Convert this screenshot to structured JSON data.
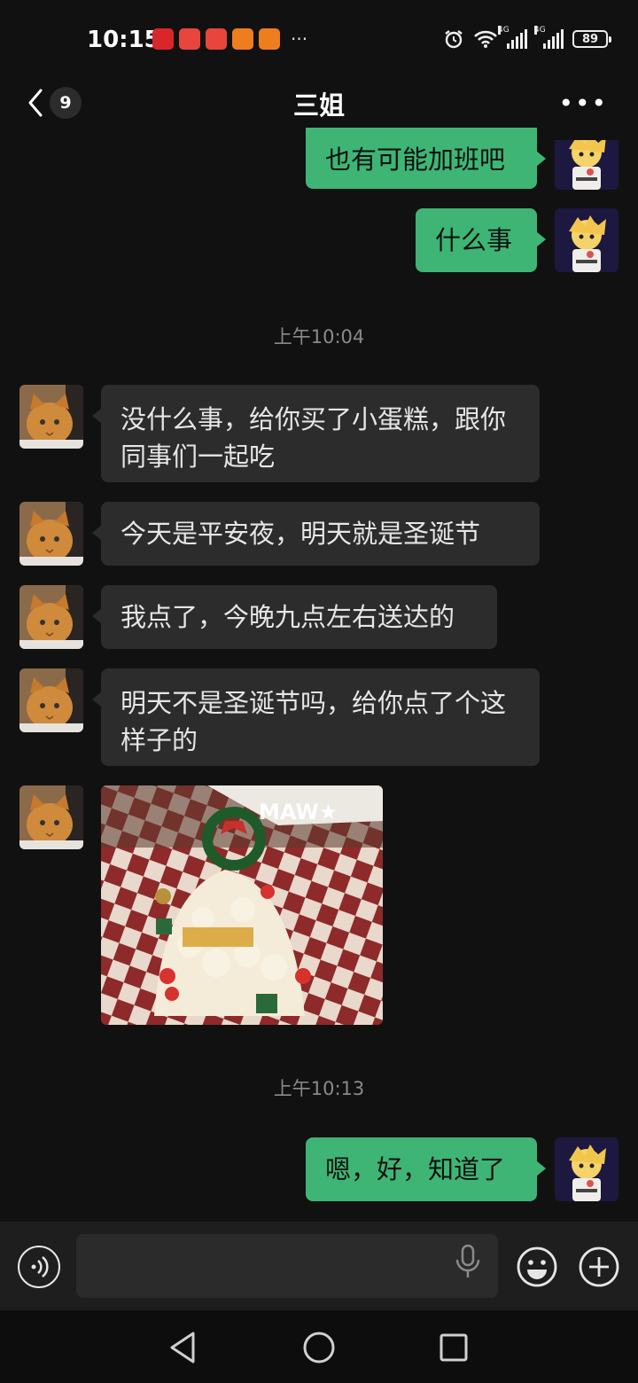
{
  "status_bar": {
    "time": "10:15",
    "more": "···",
    "battery": "89",
    "network_1": "4G",
    "network_2": "4G"
  },
  "header": {
    "back_count": "9",
    "title": "三姐",
    "more": "•••"
  },
  "messages": [
    {
      "side": "out",
      "text": "也有可能加班吧"
    },
    {
      "side": "out",
      "text": "什么事"
    },
    {
      "timestamp": "上午10:04"
    },
    {
      "side": "in",
      "text": "没什么事，给你买了小蛋糕，跟你同事们一起吃"
    },
    {
      "side": "in",
      "text": "今天是平安夜，明天就是圣诞节"
    },
    {
      "side": "in",
      "text": "我点了，今晚九点左右送达的"
    },
    {
      "side": "in",
      "text": "明天不是圣诞节吗，给你点了个这样子的"
    },
    {
      "side": "in",
      "type": "image",
      "overlay_text": "MAW★"
    },
    {
      "timestamp": "上午10:13"
    },
    {
      "side": "out",
      "text": "嗯，好，知道了"
    }
  ],
  "colors": {
    "background": "#111111",
    "incoming_bubble": "#2c2c2c",
    "outgoing_bubble": "#3eb575",
    "timestamp": "#8a8a8a"
  }
}
